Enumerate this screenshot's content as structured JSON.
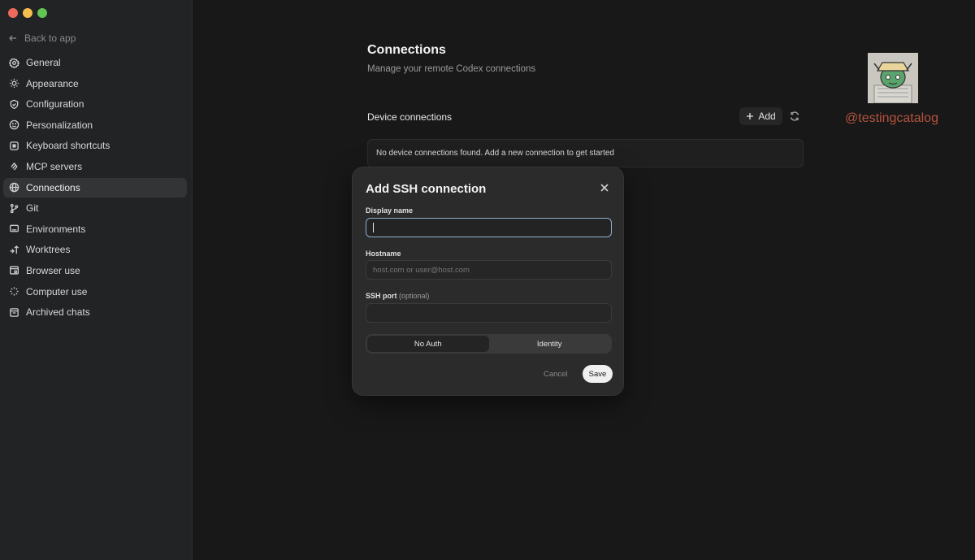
{
  "sidebar": {
    "back_label": "Back to app",
    "items": [
      {
        "label": "General",
        "icon": "gear-icon"
      },
      {
        "label": "Appearance",
        "icon": "sun-icon"
      },
      {
        "label": "Configuration",
        "icon": "shield-icon"
      },
      {
        "label": "Personalization",
        "icon": "smile-icon"
      },
      {
        "label": "Keyboard shortcuts",
        "icon": "keyboard-icon"
      },
      {
        "label": "MCP servers",
        "icon": "mcp-icon"
      },
      {
        "label": "Connections",
        "icon": "globe-icon",
        "active": true
      },
      {
        "label": "Git",
        "icon": "git-branch-icon"
      },
      {
        "label": "Environments",
        "icon": "monitor-icon"
      },
      {
        "label": "Worktrees",
        "icon": "worktree-icon"
      },
      {
        "label": "Browser use",
        "icon": "browser-icon"
      },
      {
        "label": "Computer use",
        "icon": "sparkle-icon"
      },
      {
        "label": "Archived chats",
        "icon": "archive-icon"
      }
    ]
  },
  "main": {
    "title": "Connections",
    "subtitle": "Manage your remote Codex connections",
    "section_title": "Device connections",
    "add_label": "Add",
    "empty_message": "No device connections found. Add a new connection to get started"
  },
  "watermark": "@testingcatalog",
  "dialog": {
    "title": "Add SSH connection",
    "display_name_label": "Display name",
    "display_name_value": "",
    "hostname_label": "Hostname",
    "hostname_placeholder": "host.com or user@host.com",
    "ssh_port_label": "SSH port",
    "ssh_port_optional": "(optional)",
    "ssh_port_value": "",
    "auth_options": [
      "No Auth",
      "Identity"
    ],
    "auth_selected": "No Auth",
    "cancel_label": "Cancel",
    "save_label": "Save"
  },
  "colors": {
    "accent_focus": "#8fb0d0",
    "watermark": "#b4533d",
    "traffic_red": "#ed6a5e",
    "traffic_yellow": "#f5bf4f",
    "traffic_green": "#61c554"
  }
}
